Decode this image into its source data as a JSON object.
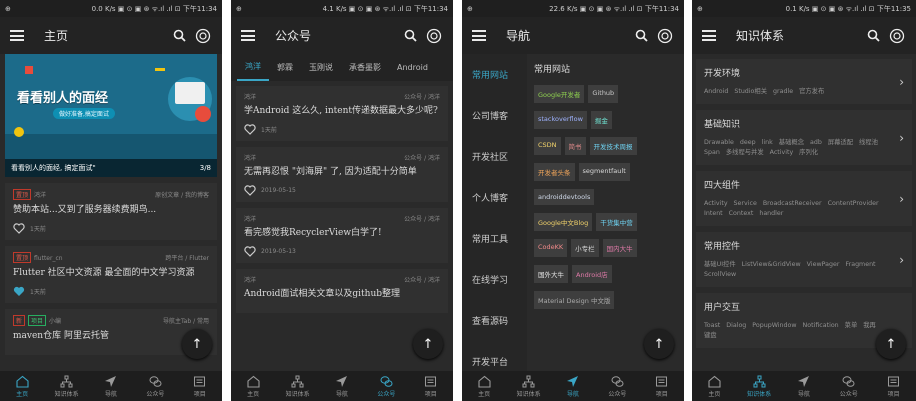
{
  "status_bars": [
    {
      "left": "⊕",
      "right": "0.0 K/s ▣ ⊙ ▣ ⊛ ᯤ.ıl .ıl ⊡ 下午11:34"
    },
    {
      "left": "⊕",
      "right": "4.1 K/s ▣ ⊙ ▣ ⊛ ᯤ.ıl .ıl ⊡ 下午11:34"
    },
    {
      "left": "⊕",
      "right": "22.6 K/s ▣ ⊙ ▣ ⊛ ᯤ.ıl .ıl ⊡ 下午11:34"
    },
    {
      "left": "⊕",
      "right": "0.1 K/s ▣ ⊙ ▣ ⊛ ᯤ.ıl .ıl ⊡ 下午11:35"
    }
  ],
  "screen1": {
    "title": "主页",
    "banner": {
      "headline": "看看别人的面经",
      "sub": "做好准备,搞定面试",
      "caption": "看看别人的面经, 搞定面试\"",
      "counter": "3/8"
    },
    "cards": [
      {
        "tag": "置顶",
        "author": "鸿洋",
        "category": "原创文章 / 我的博客",
        "title": "赞助本站...又到了服务器续费期鸟...",
        "time": "1天前",
        "liked": false
      },
      {
        "tag": "置顶",
        "author": "flutter_cn",
        "category": "跨平台 / Flutter",
        "title": "Flutter 社区中文资源 最全面的中文学习资源",
        "time": "1天前",
        "liked": true
      },
      {
        "tag": "新",
        "tag2": "项目",
        "author": "小编",
        "category": "导航主Tab / 常用",
        "title": "maven仓库 阿里云托管",
        "time": "",
        "liked": false
      }
    ]
  },
  "screen2": {
    "title": "公众号",
    "tabs": [
      "鸿洋",
      "郭霖",
      "玉刚说",
      "承香墨影",
      "Android"
    ],
    "cards": [
      {
        "author": "鸿洋",
        "category": "公众号 / 鸿洋",
        "title": "学Android 这么久, intent传递数据最大多少呢?",
        "time": "1天前"
      },
      {
        "author": "鸿洋",
        "category": "公众号 / 鸿洋",
        "title": "无需再忍恨 \"刘海屏\" 了, 因为适配十分简单",
        "time": "2019-05-15"
      },
      {
        "author": "鸿洋",
        "category": "公众号 / 鸿洋",
        "title": "看完感觉我RecyclerView白学了!",
        "time": "2019-05-13"
      },
      {
        "author": "鸿洋",
        "category": "公众号 / 鸿洋",
        "title": "Android面试相关文章以及github整理",
        "time": ""
      }
    ]
  },
  "screen3": {
    "title": "导航",
    "left_items": [
      "常用网站",
      "公司博客",
      "开发社区",
      "个人博客",
      "常用工具",
      "在线学习",
      "查看源码",
      "开发平台"
    ],
    "section_title": "常用网站",
    "chips": [
      {
        "label": "Google开发者",
        "color": "#8fd14f"
      },
      {
        "label": "Github",
        "color": "#c8c8c8"
      },
      {
        "label": "stackoverflow",
        "color": "#9fb3ff"
      },
      {
        "label": "掘金",
        "color": "#6fe0d0"
      },
      {
        "label": "CSDN",
        "color": "#f2d36b"
      },
      {
        "label": "简书",
        "color": "#e08a8a"
      },
      {
        "label": "开发技术周报",
        "color": "#6fd3f2"
      },
      {
        "label": "开发者头条",
        "color": "#f2a65a"
      },
      {
        "label": "segmentfault",
        "color": "#d8d8d8"
      },
      {
        "label": "androiddevtools",
        "color": "#cfd8e8"
      },
      {
        "label": "Google中文Blog",
        "color": "#f2d36b"
      },
      {
        "label": "干货集中营",
        "color": "#6fd3f2"
      },
      {
        "label": "CodeKK",
        "color": "#f28a8a"
      },
      {
        "label": "小专栏",
        "color": "#d8d8d8"
      },
      {
        "label": "国内大牛",
        "color": "#e07aa8"
      },
      {
        "label": "国外大牛",
        "color": "#e8e8e8"
      },
      {
        "label": "Android店",
        "color": "#e07aa8"
      },
      {
        "label": "Material Design 中文版",
        "color": "#aaaaaa"
      }
    ]
  },
  "screen4": {
    "title": "知识体系",
    "cards": [
      {
        "title": "开发环境",
        "children": "Android Studio相关 gradle 官方发布"
      },
      {
        "title": "基础知识",
        "children": "Drawable deep link 基础概念 adb 屏幕适配 线程池 Span 多线程与并发 Activity 序列化"
      },
      {
        "title": "四大组件",
        "children": "Activity Service BroadcastReceiver ContentProvider Intent Context handler"
      },
      {
        "title": "常用控件",
        "children": "基础UI控件 ListView&GridView ViewPager Fragment ScrollView"
      },
      {
        "title": "用户交互",
        "children": "Toast Dialog PopupWindow Notification 菜单 我再 键盘"
      }
    ]
  },
  "bottom_nav": [
    "主页",
    "知识体系",
    "导航",
    "公众号",
    "项目"
  ],
  "active_tabs": [
    0,
    3,
    2,
    1
  ],
  "accent_color": "#3aa6c6"
}
